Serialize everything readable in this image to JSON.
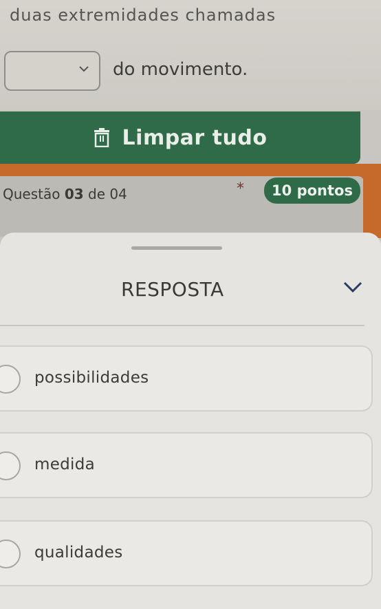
{
  "question_prompt": {
    "line_text": "duas extremidades chamadas",
    "after_dropdown_text": "do movimento."
  },
  "actions": {
    "clear_all_label": "Limpar tudo",
    "clear_icon": "trash-icon"
  },
  "question_header": {
    "label_prefix": "Questão",
    "number": "03",
    "label_mid": "de",
    "total": "04",
    "required_marker": "*",
    "points": "10 pontos"
  },
  "answer_sheet": {
    "title": "RESPOSTA",
    "options": [
      {
        "label": "possibilidades",
        "selected": false
      },
      {
        "label": "medida",
        "selected": false
      },
      {
        "label": "qualidades",
        "selected": false
      }
    ]
  },
  "colors": {
    "primary_green": "#2f6a49",
    "accent_orange": "#c56a2a"
  }
}
